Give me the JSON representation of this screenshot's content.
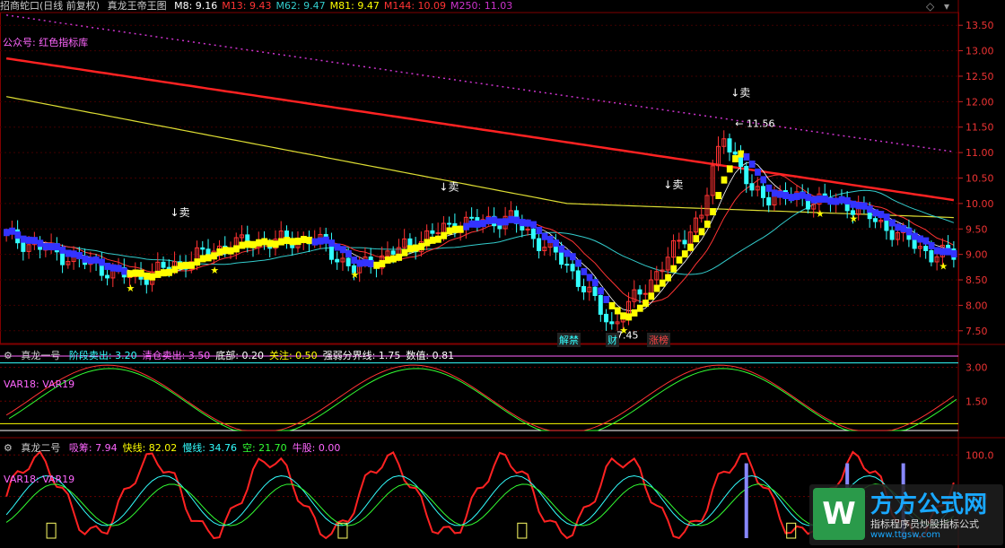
{
  "title_bar": {
    "stock_name": "招商蛇口(日线 前复权)",
    "indicator_name": "真龙王帝王图",
    "ma_values": [
      {
        "label": "M8: 9.16",
        "color": "#ffffff"
      },
      {
        "label": "M13: 9.43",
        "color": "#ff3333"
      },
      {
        "label": "M62: 9.47",
        "color": "#33cccc"
      },
      {
        "label": "M81: 9.47",
        "color": "#ffff00"
      },
      {
        "label": "M144: 10.09",
        "color": "#ff3333"
      },
      {
        "label": "M250: 11.03",
        "color": "#cc33cc"
      }
    ]
  },
  "main_panel": {
    "note": "公众号: 红色指标库",
    "sell_label": "卖",
    "high_label": "11.56",
    "low_label": "7.45",
    "event_tags": [
      {
        "text": "解禁",
        "color": "#33ffff"
      },
      {
        "text": "财",
        "color": "#33ffff"
      },
      {
        "text": "涨榜",
        "color": "#ff4444"
      }
    ],
    "y_labels": [
      "13.50",
      "13.00",
      "12.50",
      "12.00",
      "11.50",
      "11.00",
      "10.50",
      "10.00",
      "9.50",
      "9.00",
      "8.50",
      "8.00",
      "7.50"
    ]
  },
  "panel2": {
    "name": "真龙一号",
    "items": [
      {
        "label": "阶段卖出: 3.20",
        "color": "#33ffff"
      },
      {
        "label": "清仓卖出: 3.50",
        "color": "#ff66ff"
      },
      {
        "label": "底部: 0.20",
        "color": "#ffffff"
      },
      {
        "label": "关注: 0.50",
        "color": "#ffff00"
      },
      {
        "label": "强弱分界线: 1.75",
        "color": "#ffffff"
      },
      {
        "label": "数值: 0.81",
        "color": "#ffffff"
      }
    ],
    "legend": "VAR18: VAR19",
    "y_labels": [
      "3.00",
      "1.50"
    ]
  },
  "panel3": {
    "name": "真龙二号",
    "items": [
      {
        "label": "吸筹: 7.94",
        "color": "#ff66ff"
      },
      {
        "label": "快线: 82.02",
        "color": "#ffff00"
      },
      {
        "label": "慢线: 34.76",
        "color": "#33ffff"
      },
      {
        "label": "空: 21.70",
        "color": "#33ff33"
      },
      {
        "label": "牛股: 0.00",
        "color": "#ff66ff"
      }
    ],
    "legend": "VAR18: VAR19",
    "y_labels": [
      "100.0",
      "50.0"
    ]
  },
  "watermark": {
    "brand": "方方公式网",
    "slogan": "指标程序员炒股指标公式",
    "url": "www.ttgsw.com"
  },
  "colors": {
    "up": "#ff3333",
    "down": "#33ffff",
    "blue_band": "#3333ff",
    "yellow_band": "#ffff00",
    "grid": "#800000"
  },
  "chart_data": {
    "type": "candlestick",
    "y_range": [
      7.25,
      13.75
    ],
    "ohlc_start_close": 9.4
  }
}
